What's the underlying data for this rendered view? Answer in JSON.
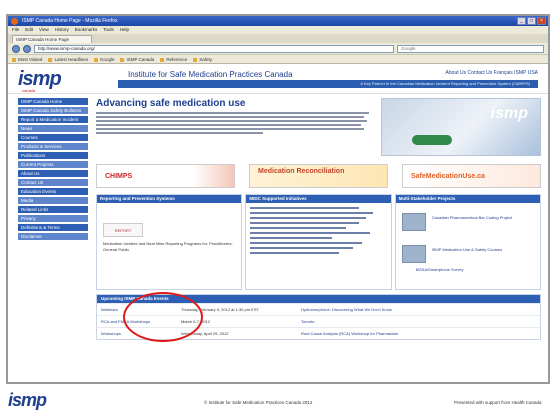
{
  "window": {
    "title": "ISMP Canada Home Page - Mozilla Firefox"
  },
  "menu": [
    "File",
    "Edit",
    "View",
    "History",
    "Bookmarks",
    "Tools",
    "Help"
  ],
  "tab": {
    "label": "ISMP Canada Home Page"
  },
  "address": {
    "url": "http://www.ismp-canada.org/",
    "search_placeholder": "Google"
  },
  "bookmarks": [
    "Most Visited",
    "Latest Headlines",
    "Google",
    "ISMP Canada",
    "Reference",
    "Safety"
  ],
  "site": {
    "logo": "ismp",
    "logo_sub": "canada",
    "institute": "Institute for Safe Medication Practices Canada",
    "toplinks": "About Us  Contact Us  Français  ISMP USA",
    "bluebar": "A Key Partner in the Canadian Medication Incident Reporting and Prevention System (CMIRPS)"
  },
  "sidebar": [
    "ISMP Canada Home",
    "ISMP Canada Safety Bulletins",
    "Report a Medication Incident",
    "News",
    "Courses",
    "Products & Services",
    "Publications",
    "Current Projects",
    "About Us",
    "Contact Us",
    "Education Events",
    "Media",
    "Related Links",
    "Privacy",
    "Definitions & Terms",
    "Disclaimer"
  ],
  "hero": {
    "title": "Advancing safe medication use",
    "image_logo": "ismp"
  },
  "banners": {
    "b1": "CHIMPS",
    "b2": "Medication Reconciliation",
    "b3": "SafeMedicationUse.ca"
  },
  "columns": {
    "c1": {
      "header": "Reporting and Prevention Systems",
      "small_box": "REPORT",
      "small_text": "Medication Incident and Near Miss Reporting Programs for: Practitioners, General Public"
    },
    "c2": {
      "header": "MIDC Supported Initiatives"
    },
    "c3": {
      "header": "Multi-Stakeholder Projects",
      "t1": "Canadian Pharmaceutical Bar Coding Project",
      "t2": "ISMP Medication Use & Safety Courses",
      "t3": "MSSA/Smartphone Survey"
    }
  },
  "events": {
    "header": "Upcoming ISMP Canada Events",
    "rows": [
      {
        "c": "Webinars",
        "d": "Thursday, February 9, 2012 at 1:30 pm EST",
        "e": "Hydromorphone: Discovering What We Don't Know"
      },
      {
        "c": "RCA and FMEA Workshops",
        "d": "March 6-7, 2012",
        "e": "Toronto"
      },
      {
        "c": "Workshops",
        "d": "Wednesday, April 25, 2012",
        "e": "Root Cause Analysis (RCA) Workshop for Pharmacists"
      }
    ]
  },
  "footer": {
    "logo": "ismp",
    "copy": "© Institute for Safe Medication Practices Canada 2012",
    "support": "Presented with support from Health Canada"
  }
}
